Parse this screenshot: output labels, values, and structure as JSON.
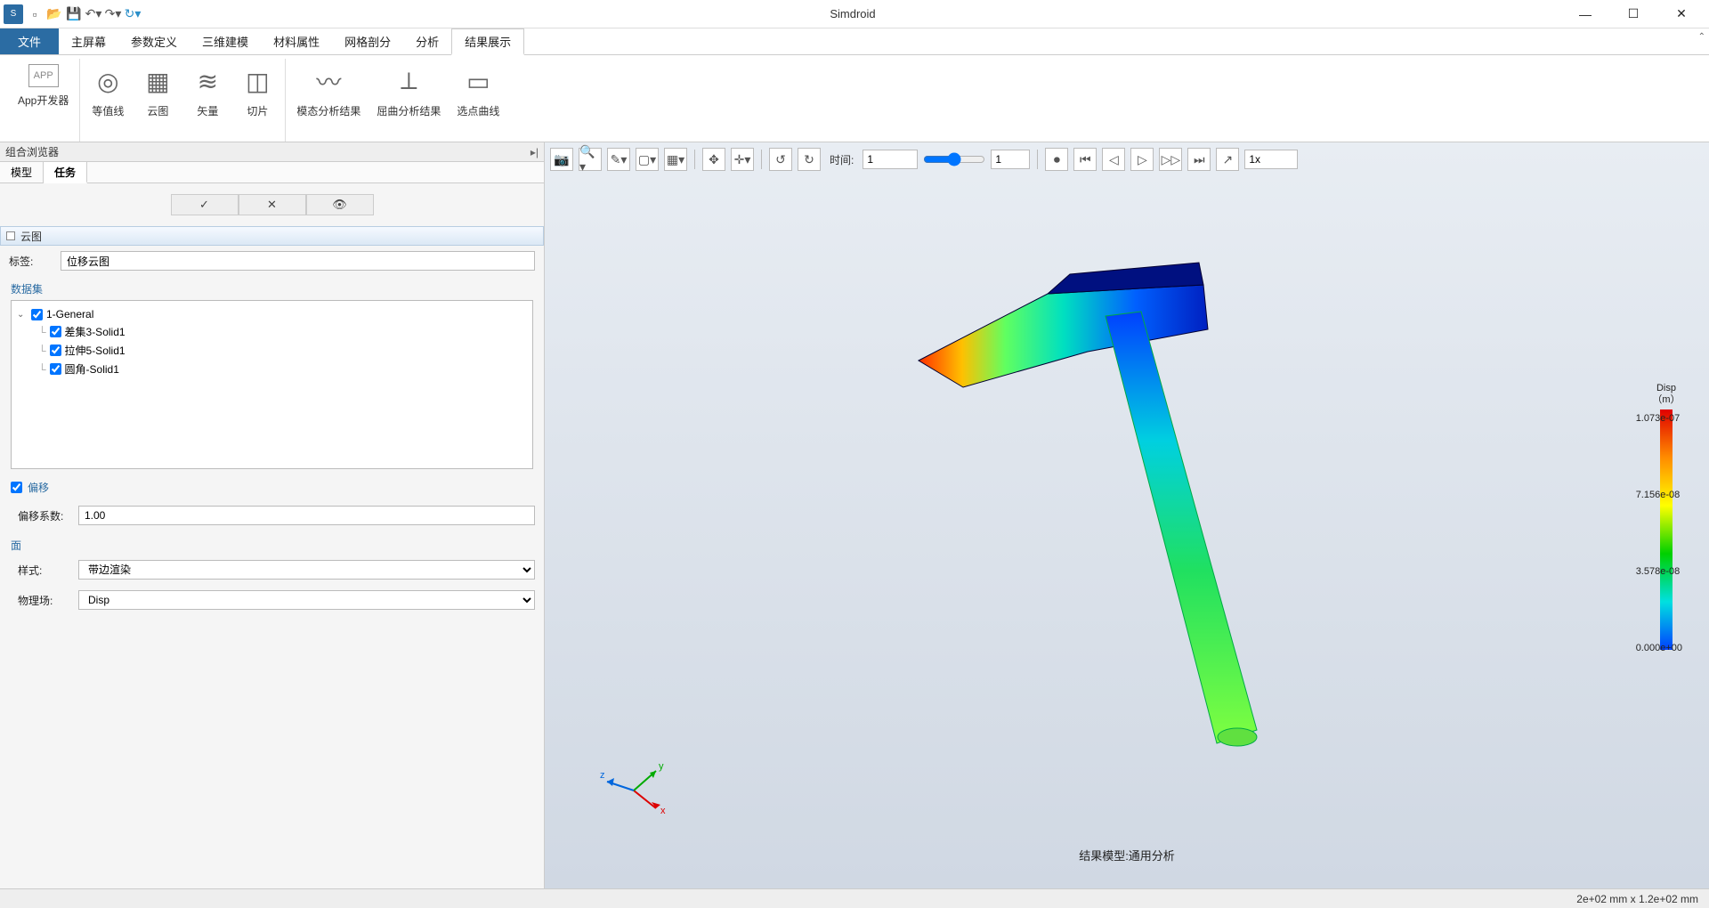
{
  "app": {
    "title": "Simdroid"
  },
  "menubar": {
    "file": "文件",
    "items": [
      "主屏幕",
      "参数定义",
      "三维建模",
      "材料属性",
      "网格剖分",
      "分析",
      "结果展示"
    ],
    "active_index": 6
  },
  "ribbon": {
    "groups": [
      [
        {
          "label": "App开发器",
          "icon": "APP"
        }
      ],
      [
        {
          "label": "等值线",
          "icon": "◎"
        },
        {
          "label": "云图",
          "icon": "▦"
        },
        {
          "label": "矢量",
          "icon": "≋"
        },
        {
          "label": "切片",
          "icon": "🖨"
        }
      ],
      [
        {
          "label": "模态分析结果",
          "icon": "〰"
        },
        {
          "label": "屈曲分析结果",
          "icon": "⟂"
        },
        {
          "label": "选点曲线",
          "icon": "▭"
        }
      ]
    ]
  },
  "sidepanel": {
    "title": "组合浏览器",
    "tabs": [
      "模型",
      "任务"
    ],
    "active_tab": 1,
    "section_header": "云图",
    "label_field": {
      "label": "标签:",
      "value": "位移云图"
    },
    "dataset": {
      "label": "数据集",
      "root": "1-General",
      "children": [
        "差集3-Solid1",
        "拉伸5-Solid1",
        "圆角-Solid1"
      ]
    },
    "offset": {
      "checkbox_label": "偏移",
      "coef_label": "偏移系数:",
      "coef_value": "1.00"
    },
    "face": {
      "label": "面",
      "style_label": "样式:",
      "style_value": "带边渲染",
      "field_label": "物理场:",
      "field_value": "Disp"
    }
  },
  "view_toolbar": {
    "time_label": "时间:",
    "time_value": "1",
    "frame_value": "1",
    "speed_value": "1x"
  },
  "viewport": {
    "bottom_label": "结果模型:通用分析",
    "legend": {
      "title_line1": "Disp",
      "title_line2": "（m）",
      "ticks": [
        "1.073e-07",
        "7.156e-08",
        "3.578e-08",
        "0.000e+00"
      ]
    },
    "axes": {
      "x": "x",
      "y": "y",
      "z": "z"
    }
  },
  "statusbar": {
    "dims": "2e+02 mm x 1.2e+02 mm"
  }
}
